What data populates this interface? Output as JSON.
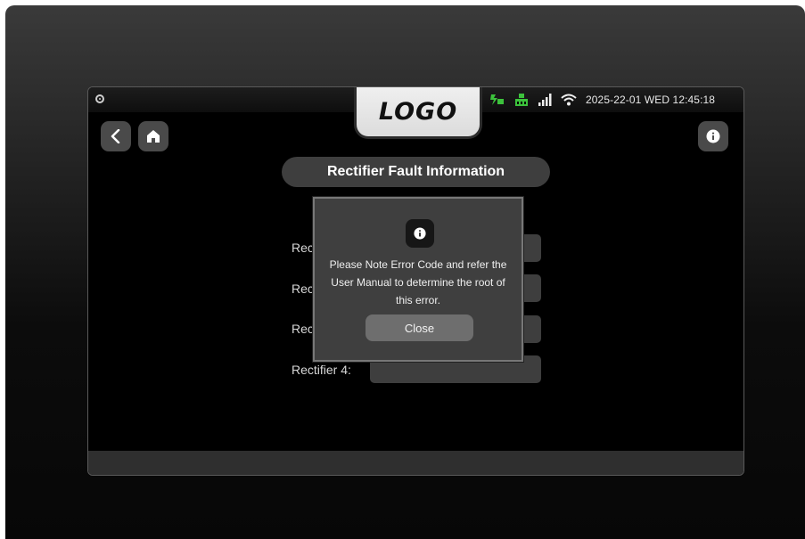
{
  "header": {
    "logo_text": "LOGO",
    "datetime": "2025-22-01 WED 12:45:18",
    "status_icons": [
      "power-icon",
      "network-icon",
      "signal-bars-icon",
      "wifi-icon"
    ],
    "accent_green": "#3cc23c"
  },
  "nav": {
    "back_icon": "chevron-left-icon",
    "home_icon": "home-icon",
    "info_icon": "info-icon"
  },
  "page": {
    "title": "Rectifier Fault Information",
    "rows": [
      {
        "label": "Rec",
        "value": ""
      },
      {
        "label": "Rec",
        "value": ""
      },
      {
        "label": "Rec",
        "value": ""
      },
      {
        "label": "Rectifier 4:",
        "value": ""
      }
    ]
  },
  "dialog": {
    "icon": "info-icon",
    "message": "Please Note Error Code and refer the User Manual to determine the root of this error.",
    "close_label": "Close"
  }
}
